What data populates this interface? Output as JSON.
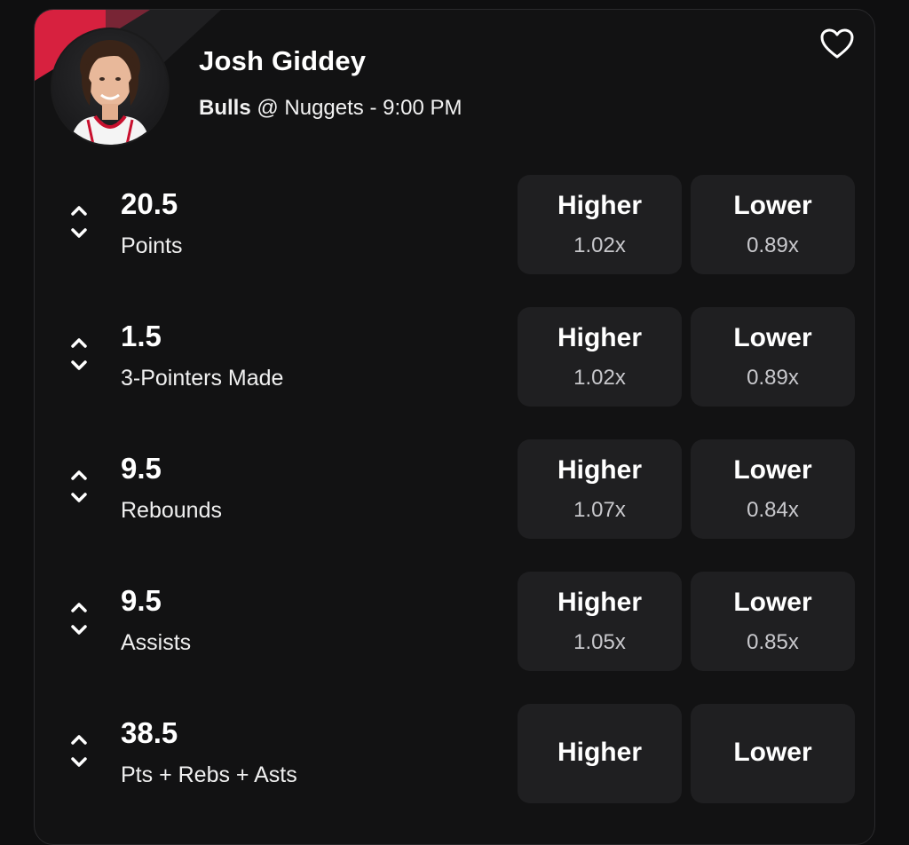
{
  "player": {
    "name": "Josh Giddey",
    "team": "Bulls",
    "matchup_rest": " @ Nuggets - 9:00 PM"
  },
  "accent_color": "#d7213f",
  "icons": {
    "favorite": "heart-outline-icon",
    "sort": "chevron-up-down-icon"
  },
  "props": [
    {
      "line": "20.5",
      "stat": "Points",
      "higher_label": "Higher",
      "higher_mult": "1.02x",
      "lower_label": "Lower",
      "lower_mult": "0.89x"
    },
    {
      "line": "1.5",
      "stat": "3-Pointers Made",
      "higher_label": "Higher",
      "higher_mult": "1.02x",
      "lower_label": "Lower",
      "lower_mult": "0.89x"
    },
    {
      "line": "9.5",
      "stat": "Rebounds",
      "higher_label": "Higher",
      "higher_mult": "1.07x",
      "lower_label": "Lower",
      "lower_mult": "0.84x"
    },
    {
      "line": "9.5",
      "stat": "Assists",
      "higher_label": "Higher",
      "higher_mult": "1.05x",
      "lower_label": "Lower",
      "lower_mult": "0.85x"
    },
    {
      "line": "38.5",
      "stat": "Pts + Rebs + Asts",
      "higher_label": "Higher",
      "lower_label": "Lower"
    }
  ]
}
